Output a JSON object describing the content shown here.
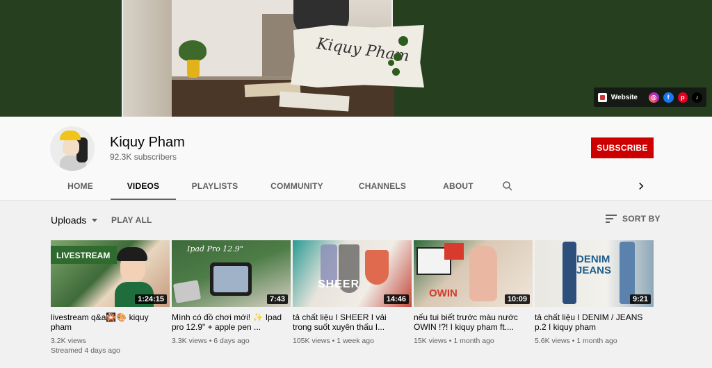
{
  "banner": {
    "signature": "Kiquy Pham",
    "links": {
      "website_label": "Website",
      "icons": [
        "instagram-icon",
        "facebook-icon",
        "pinterest-icon",
        "tiktok-icon"
      ]
    }
  },
  "channel": {
    "name": "Kiquy Pham",
    "subscribers": "92.3K subscribers",
    "subscribe_label": "SUBSCRIBE"
  },
  "tabs": [
    {
      "label": "HOME"
    },
    {
      "label": "VIDEOS"
    },
    {
      "label": "PLAYLISTS"
    },
    {
      "label": "COMMUNITY"
    },
    {
      "label": "CHANNELS"
    },
    {
      "label": "ABOUT"
    }
  ],
  "active_tab": "VIDEOS",
  "toolbar": {
    "uploads_label": "Uploads",
    "play_all_label": "PLAY ALL",
    "sort_label": "SORT BY"
  },
  "videos": [
    {
      "title": "livestream q&a🎇🎨 kiquy pham",
      "views": "3.2K views",
      "age": "Streamed 4 days ago",
      "duration": "1:24:15",
      "thumb_text": "LIVESTREAM"
    },
    {
      "title": "Mình có đồ chơi mới! ✨ Ipad pro 12.9\" + apple pen ...",
      "views": "3.3K views",
      "age": "6 days ago",
      "duration": "7:43",
      "thumb_text": "Ipad Pro 12.9\""
    },
    {
      "title": "tả chất liệu I SHEER I vải trong suốt xuyên thấu I...",
      "views": "105K views",
      "age": "1 week ago",
      "duration": "14:46",
      "thumb_text": "SHEER"
    },
    {
      "title": "nếu tui biết trước màu nước OWIN !?! I kiquy pham ft....",
      "views": "15K views",
      "age": "1 month ago",
      "duration": "10:09",
      "thumb_text": "OWIN"
    },
    {
      "title": "tả chất liệu I DENIM / JEANS p.2 I kiquy pham",
      "views": "5.6K views",
      "age": "1 month ago",
      "duration": "9:21",
      "thumb_text": "DENIM JEANS"
    }
  ],
  "colors": {
    "subscribe": "#cc0000",
    "banner_bg": "#263f1f"
  }
}
